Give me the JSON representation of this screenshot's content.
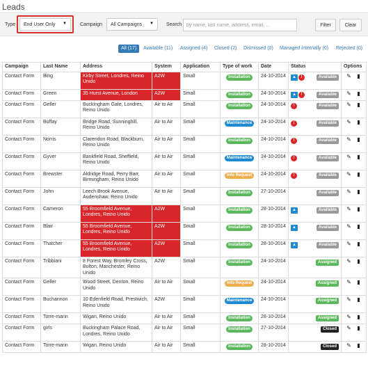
{
  "page": {
    "title": "Leads"
  },
  "filters": {
    "type_label": "Type",
    "type_value": "End User Only",
    "campaign_label": "Campaign",
    "campaign_value": "All Campaigns",
    "search_label": "Search",
    "search_placeholder": "by name, last name, address, email, ...",
    "filter_button": "Filter",
    "clear_button": "Clear"
  },
  "tabs": [
    {
      "label": "All (17)",
      "active": true
    },
    {
      "label": "Available (11)"
    },
    {
      "label": "Assigned (4)"
    },
    {
      "label": "Closed (2)"
    },
    {
      "label": "Dismissed (0)"
    },
    {
      "label": "Managed Internally (0)"
    },
    {
      "label": "Rejected (0)"
    }
  ],
  "table": {
    "headers": [
      "Campaign",
      "Last Name",
      "Address",
      "System",
      "Application",
      "Type of work",
      "Date",
      "Status",
      "Options"
    ],
    "rows": [
      {
        "campaign": "Contact Form",
        "last_name": "Bing",
        "address": "Kirby Street, Londres, Reino Unido",
        "system": "A2W",
        "application": "Small",
        "work": "Installation",
        "date": "24-10-2014",
        "status": "Available",
        "bell": true,
        "alert": true,
        "red": true
      },
      {
        "campaign": "Contact Form",
        "last_name": "Green",
        "address": "35 Hurst Avenue, London",
        "system": "A2W",
        "application": "Small",
        "work": "Installation",
        "date": "24-10-2014",
        "status": "Available",
        "bell": true,
        "alert": true,
        "red": true
      },
      {
        "campaign": "Contact Form",
        "last_name": "Geller",
        "address": "Buckingham Gate, Londres, Reino Unido",
        "system": "Air to Air",
        "application": "Small",
        "work": "Installation",
        "date": "24-10-2014",
        "status": "Available",
        "bell": false,
        "alert": true,
        "red": false
      },
      {
        "campaign": "Contact Form",
        "last_name": "Buffay",
        "address": "Bridge Road, Sunninghill, Reino Unido",
        "system": "Air to Air",
        "application": "Small",
        "work": "Maintenance",
        "date": "24-10-2014",
        "status": "Available",
        "bell": false,
        "alert": true,
        "red": false
      },
      {
        "campaign": "Contact Form",
        "last_name": "Norris",
        "address": "Clarendon Road, Blackburn, Reino Unido",
        "system": "Air to Air",
        "application": "Small",
        "work": "Installation",
        "date": "24-10-2014",
        "status": "Available",
        "bell": false,
        "alert": true,
        "red": false
      },
      {
        "campaign": "Contact Form",
        "last_name": "Gyver",
        "address": "Bankfield Road, Sheffield, Reino Unido",
        "system": "Air to Air",
        "application": "Small",
        "work": "Maintenance",
        "date": "24-10-2014",
        "status": "Available",
        "bell": false,
        "alert": true,
        "red": false
      },
      {
        "campaign": "Contact Form",
        "last_name": "Brewster",
        "address": "Aldridge Road, Perry Barr, Birmingham, Reino Unido",
        "system": "Air to Air",
        "application": "Small",
        "work": "Info Request",
        "date": "24-10-2014",
        "status": "Available",
        "bell": false,
        "alert": true,
        "red": false
      },
      {
        "campaign": "Contact Form",
        "last_name": "John",
        "address": "Leech Brook Avenue, Audenshaw, Reino Unido",
        "system": "Air to Air",
        "application": "Small",
        "work": "Installation",
        "date": "27-10-2014",
        "status": "Available",
        "bell": false,
        "alert": false,
        "red": false
      },
      {
        "campaign": "Contact Form",
        "last_name": "Cameron",
        "address": "55 Broomfield Avenue, Londres, Reino Unido",
        "system": "A2W",
        "application": "Small",
        "work": "Installation",
        "date": "28-10-2014",
        "status": "Available",
        "bell": true,
        "alert": false,
        "red": true
      },
      {
        "campaign": "Contact Form",
        "last_name": "Blair",
        "address": "55 Broomfield Avenue, Londres, Reino Unido",
        "system": "A2W",
        "application": "Small",
        "work": "Installation",
        "date": "28-10-2014",
        "status": "Available",
        "bell": true,
        "alert": false,
        "red": true
      },
      {
        "campaign": "Contact Form",
        "last_name": "Thatcher",
        "address": "55 Broomfield Avenue, Londres, Reino Unido",
        "system": "A2W",
        "application": "Small",
        "work": "Installation",
        "date": "28-10-2014",
        "status": "Available",
        "bell": true,
        "alert": false,
        "red": true
      },
      {
        "campaign": "Contact Form",
        "last_name": "Tribbiani",
        "address": "8 Forest Way, Bromley Cross, Bolton, Manchester, Reino Unido",
        "system": "A2W",
        "application": "Small",
        "work": "Installation",
        "date": "24-10-2014",
        "status": "Assigned",
        "bell": false,
        "alert": false,
        "red": false
      },
      {
        "campaign": "Contact Form",
        "last_name": "Geller",
        "address": "Wood Street, Denton, Reino Unido",
        "system": "Air to Air",
        "application": "Small",
        "work": "Info Request",
        "date": "24-10-2014",
        "status": "Assigned",
        "bell": false,
        "alert": false,
        "red": false
      },
      {
        "campaign": "Contact Form",
        "last_name": "Buchannon",
        "address": "10 Edenfield Road, Prestwich, Reino Unido",
        "system": "A2W",
        "application": "Small",
        "work": "Maintenance",
        "date": "24-10-2014",
        "status": "Assigned",
        "bell": false,
        "alert": false,
        "red": false
      },
      {
        "campaign": "Contact Form",
        "last_name": "Torre-marin",
        "address": "Wigan, Reino Unido",
        "system": "Air to Air",
        "application": "Small",
        "work": "Installation",
        "date": "28-10-2014",
        "status": "Assigned",
        "bell": false,
        "alert": false,
        "red": false
      },
      {
        "campaign": "Contact Form",
        "last_name": "girls",
        "address": "Buckingham Palace Road, Londres, Reino Unido",
        "system": "Air to Air",
        "application": "Small",
        "work": "Installation",
        "date": "27-10-2014",
        "status": "Closed",
        "bell": false,
        "alert": false,
        "red": false
      },
      {
        "campaign": "Contact Form",
        "last_name": "Torre-marin",
        "address": "Wigan, Reino Unido",
        "system": "Air to Air",
        "application": "Small",
        "work": "Installation",
        "date": "28-10-2014",
        "status": "Closed",
        "bell": false,
        "alert": false,
        "red": false
      }
    ]
  },
  "icons": {
    "bell": "bell-icon",
    "alert": "alert-icon",
    "edit": "edit-icon",
    "delete": "trash-icon",
    "caret": "chevron-down-icon"
  },
  "colors": {
    "accent": "#337ab7",
    "highlight": "#d9262a",
    "installation": "#5cb85c",
    "maintenance": "#1f8ad1",
    "info_request": "#f0ad4e"
  }
}
